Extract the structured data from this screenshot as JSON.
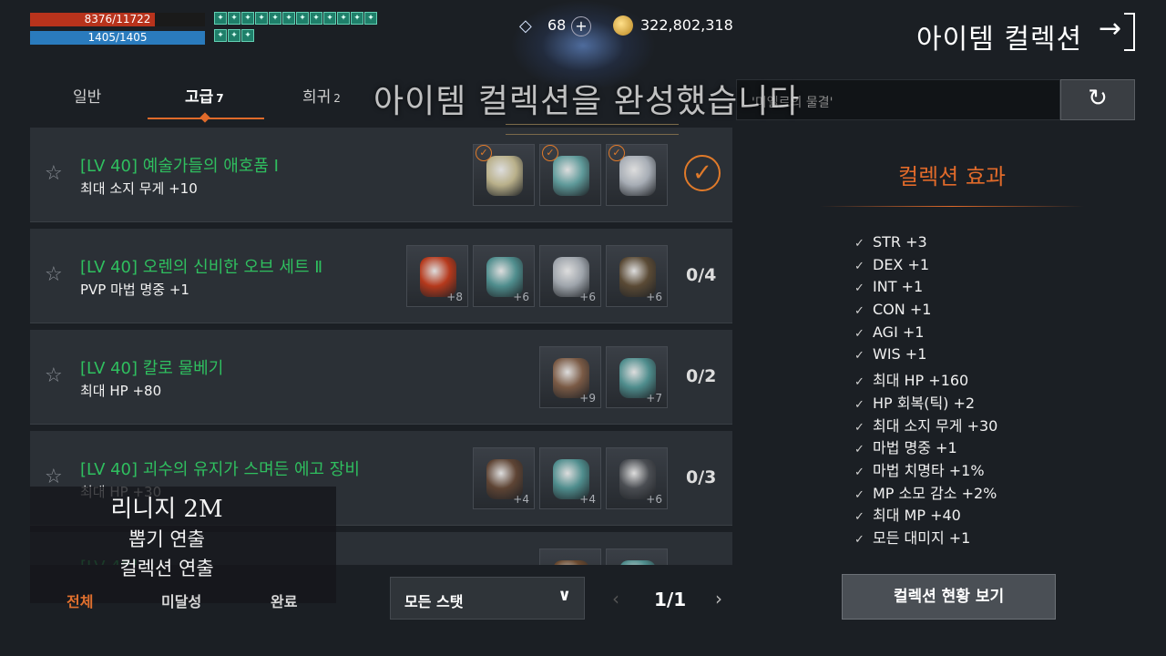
{
  "player": {
    "hp_text": "8376/11722",
    "hp_fraction": 0.7146,
    "mp_text": "1405/1405",
    "mp_fraction": 1.0
  },
  "buffs": [
    "buff-icon",
    "buff-icon",
    "buff-icon",
    "buff-icon",
    "buff-icon",
    "buff-icon",
    "buff-icon",
    "buff-icon",
    "buff-icon",
    "buff-icon",
    "buff-icon",
    "buff-icon",
    "buff-icon",
    "buff-icon",
    "buff-icon"
  ],
  "currency": {
    "gem_icon": "diamond-icon",
    "gem_count": "68",
    "plus_label": "+",
    "gold_icon": "gold-coin-icon",
    "gold_count": "322,802,318"
  },
  "header": {
    "title": "아이템 컬렉션",
    "exit_icon": "→"
  },
  "tabs": [
    {
      "label": "일반",
      "count": ""
    },
    {
      "label": "고급",
      "count": "7"
    },
    {
      "label": "희귀",
      "count": "2"
    }
  ],
  "search": {
    "placeholder": "'미엘르의 물결'",
    "reset_icon": "↻"
  },
  "notification": {
    "text": "아이템 컬렉션을 완성했습니다"
  },
  "collections": [
    {
      "title": "[LV 40] 예술가들의 애호품 Ⅰ",
      "effect": "최대 소지 무게 +10",
      "completed": true,
      "progress": "",
      "items": [
        {
          "plus": "",
          "checked": true,
          "color": "#b9b08a"
        },
        {
          "plus": "",
          "checked": true,
          "color": "#5f9a9a"
        },
        {
          "plus": "",
          "checked": true,
          "color": "#a7adb5"
        }
      ]
    },
    {
      "title": "[LV 40] 오렌의 신비한 오브 세트 Ⅱ",
      "effect": "PVP 마법 명중 +1",
      "completed": false,
      "progress": "0/4",
      "items": [
        {
          "plus": "+8",
          "checked": false,
          "color": "#b5391c"
        },
        {
          "plus": "+6",
          "checked": false,
          "color": "#4f8d8d"
        },
        {
          "plus": "+6",
          "checked": false,
          "color": "#9ea4ab"
        },
        {
          "plus": "+6",
          "checked": false,
          "color": "#5a4a35"
        }
      ]
    },
    {
      "title": "[LV 40] 칼로 물베기",
      "effect": "최대 HP +80",
      "completed": false,
      "progress": "0/2",
      "items": [
        {
          "plus": "+9",
          "checked": false,
          "color": "#7a5a45"
        },
        {
          "plus": "+7",
          "checked": false,
          "color": "#4f8d8d"
        }
      ]
    },
    {
      "title": "[LV 40] 괴수의 유지가 스며든 에고 장비",
      "effect": "최대 HP +30",
      "completed": false,
      "progress": "0/3",
      "items": [
        {
          "plus": "+4",
          "checked": false,
          "color": "#5e4434"
        },
        {
          "plus": "+4",
          "checked": false,
          "color": "#4f8d8d"
        },
        {
          "plus": "+6",
          "checked": false,
          "color": "#4a4d52"
        }
      ]
    },
    {
      "title": "[LV 40] ",
      "effect": "",
      "completed": false,
      "progress": "",
      "items": [
        {
          "plus": "",
          "checked": false,
          "color": "#6a4a30"
        },
        {
          "plus": "",
          "checked": false,
          "color": "#4f8d8d"
        }
      ]
    }
  ],
  "filters": {
    "tabs": [
      "전체",
      "미달성",
      "완료"
    ],
    "stat_select": "모든 스탯",
    "page": "1/1"
  },
  "watermark": {
    "line1": "리니지 2M",
    "line2": "뽑기 연출",
    "line3": "컬렉션 연출"
  },
  "effects": {
    "title": "컬렉션 효과",
    "items": [
      "STR +3",
      "DEX +1",
      "INT +1",
      "CON +1",
      "AGI +1",
      "WIS +1",
      "최대 HP +160",
      "HP 회복(틱) +2",
      "최대 소지 무게 +30",
      "마법 명중 +1",
      "마법 치명타 +1%",
      "MP 소모 감소 +2%",
      "최대 MP +40",
      "모든 대미지 +1"
    ],
    "button_label": "컬렉션 현황 보기"
  },
  "colors": {
    "accent": "#e06a2a",
    "title_green": "#2fbf5f",
    "hp": "#b8331c",
    "mp": "#2a7bbd"
  }
}
